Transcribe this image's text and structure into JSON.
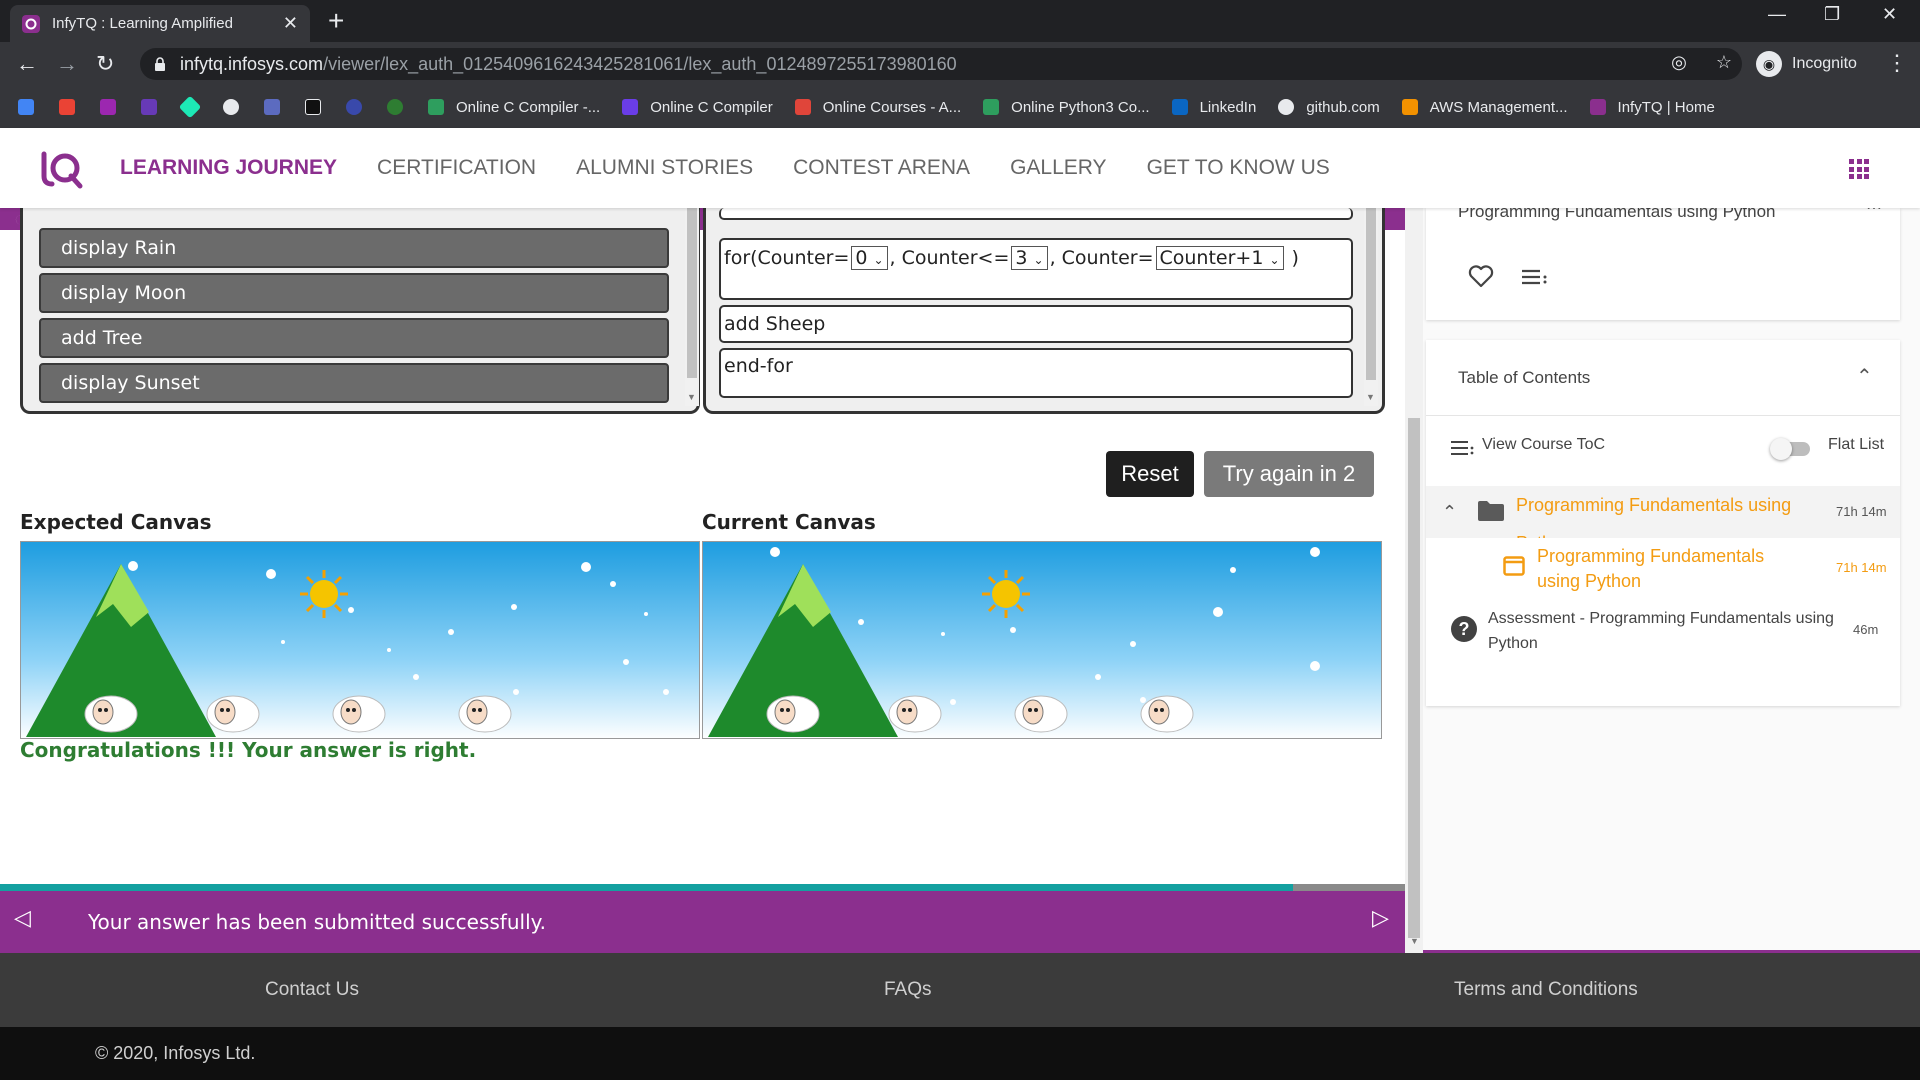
{
  "browser": {
    "tab_title": "InfyTQ : Learning Amplified",
    "tab_close": "✕",
    "new_tab": "+",
    "url_host": "infytq.infosys.com",
    "url_path": "/viewer/lex_auth_01254096162434252810​61/lex_auth_0124897255173980160",
    "incognito_label": "Incognito",
    "bookmarks": [
      {
        "label": "Online C Compiler -...",
        "color": "#2e9e5e"
      },
      {
        "label": "Online C Compiler",
        "color": "#6a3de8"
      },
      {
        "label": "Online Courses - A...",
        "color": "#e0453a"
      },
      {
        "label": "Online Python3 Co...",
        "color": "#2e9e5e"
      },
      {
        "label": "LinkedIn",
        "color": "#0a66c2"
      },
      {
        "label": "github.com",
        "color": "#e8eaed"
      },
      {
        "label": "AWS Management...",
        "color": "#f29100"
      },
      {
        "label": "InfyTQ | Home",
        "color": "#8b2f8e"
      }
    ]
  },
  "site": {
    "brand_color": "#8b2f8e",
    "nav": [
      {
        "label": "LEARNING JOURNEY",
        "active": true
      },
      {
        "label": "CERTIFICATION",
        "active": false
      },
      {
        "label": "ALUMNI STORIES",
        "active": false
      },
      {
        "label": "CONTEST ARENA",
        "active": false
      },
      {
        "label": "GALLERY",
        "active": false
      },
      {
        "label": "GET TO KNOW US",
        "active": false
      }
    ]
  },
  "exercise": {
    "code_blocks": [
      "display Rain",
      "display Moon",
      "add Tree",
      "display Sunset"
    ],
    "for_stmt": {
      "prefix": "for(Counter=",
      "start": "0",
      "mid": ", Counter<=",
      "end": "3",
      "mid2": ", Counter=",
      "step": "Counter+1",
      "suffix": " )"
    },
    "stmt_add": "add Sheep",
    "stmt_end": "end-for",
    "reset_label": "Reset",
    "try_label": "Try again in 2",
    "expected_label": "Expected Canvas",
    "current_label": "Current Canvas",
    "congrats": "Congratulations !!! Your answer is right.",
    "progress_fraction": 0.92,
    "banner_msg": "Your answer has been submitted successfully."
  },
  "sidebar": {
    "course_title": "Programming Fundamentals using Python",
    "toc_title": "Table of Contents",
    "view_toc": "View Course ToC",
    "flat_list": "Flat List",
    "items": [
      {
        "name": "Programming Fundamentals using Python",
        "time": "71h 14m"
      },
      {
        "name": "Programming Fundamentals using Python",
        "time": "71h 14m"
      },
      {
        "name": "Assessment - Programming Fundamentals using Python",
        "time": "46m"
      }
    ]
  },
  "footer": {
    "contact": "Contact Us",
    "faqs": "FAQs",
    "terms": "Terms and Conditions",
    "copyright": "© 2020, Infosys Ltd."
  }
}
